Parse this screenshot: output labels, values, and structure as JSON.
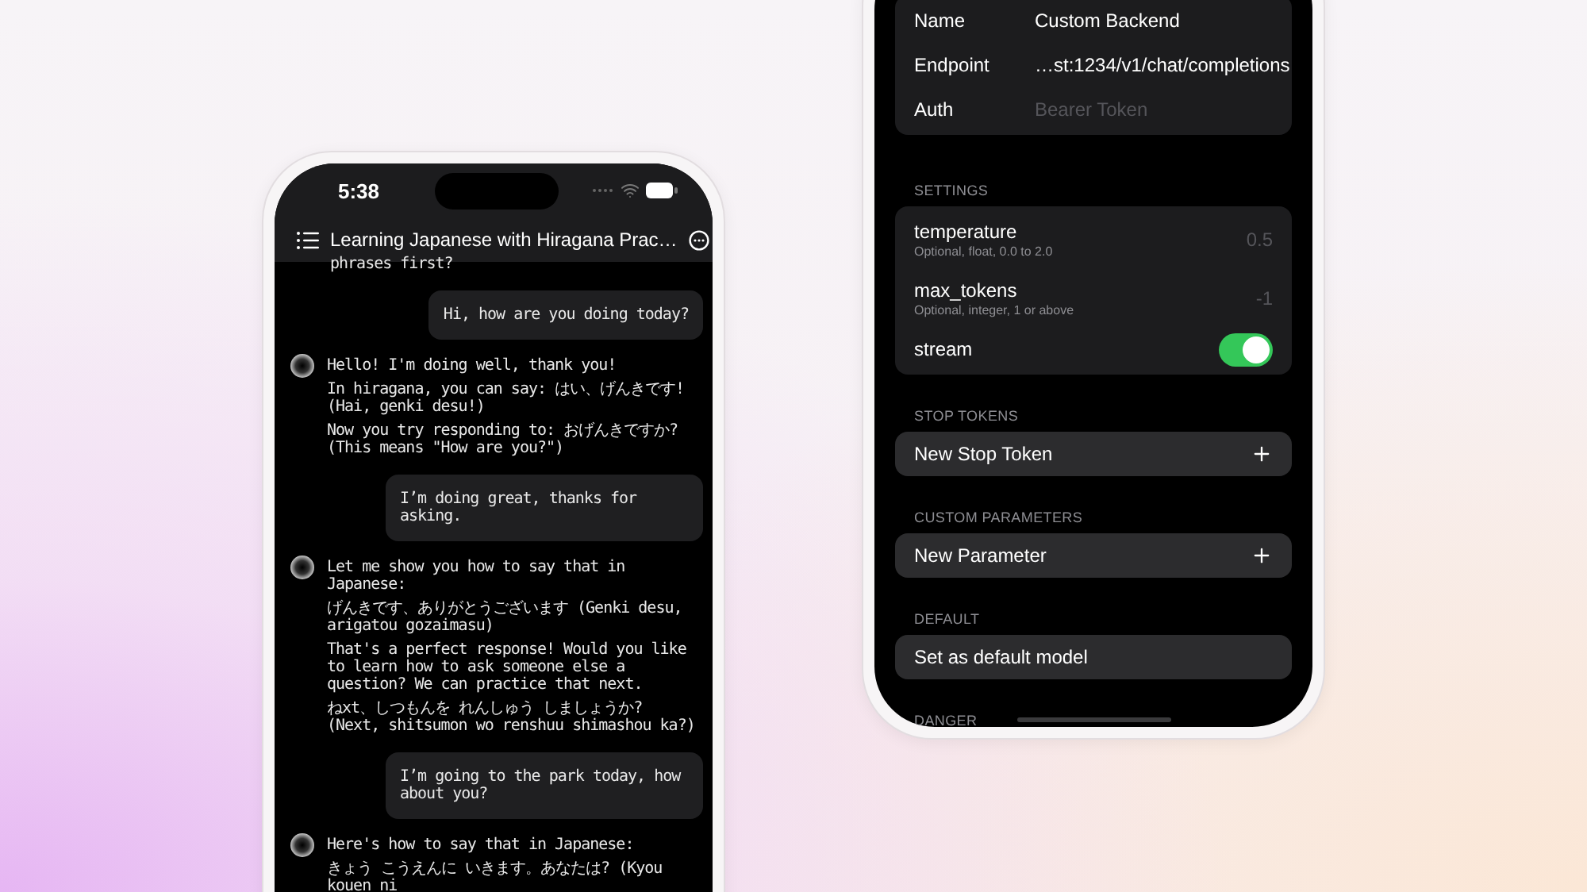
{
  "chat": {
    "time": "5:38",
    "title": "Learning Japanese with Hiragana Prac…",
    "messages": [
      {
        "kind": "assistant",
        "avatar": false,
        "paragraphs": [
          "phrases first?"
        ]
      },
      {
        "kind": "user",
        "paragraphs": [
          "Hi, how are you doing today?"
        ]
      },
      {
        "kind": "assistant",
        "avatar": true,
        "paragraphs": [
          "Hello! I'm doing well, thank you!",
          "In hiragana, you can say: はい、げんきです! (Hai, genki desu!)",
          "Now you try responding to: おげんきですか? (This means \"How are you?\")"
        ]
      },
      {
        "kind": "user",
        "paragraphs": [
          "I’m doing great, thanks for asking."
        ]
      },
      {
        "kind": "assistant",
        "avatar": true,
        "paragraphs": [
          "Let me show you how to say that in Japanese:",
          "げんきです、ありがとうございます (Genki desu, arigatou gozaimasu)",
          "That's a perfect response! Would you like to learn how to ask someone else a question? We can practice that next.",
          "ねxt、しつもんを れんしゅう しましょうか? (Next, shitsumon wo renshuu shimashou ka?)"
        ]
      },
      {
        "kind": "user",
        "paragraphs": [
          "I’m going to the park today, how about you?"
        ]
      },
      {
        "kind": "assistant",
        "avatar": true,
        "paragraphs": [
          "Here's how to say that in Japanese:",
          "きょう こうえんに いきます。あなたは? (Kyou kouen ni"
        ]
      }
    ]
  },
  "settings": {
    "connection": [
      {
        "label": "Name",
        "value": "Custom Backend"
      },
      {
        "label": "Endpoint",
        "value": "…st:1234/v1/chat/completions"
      },
      {
        "label": "Auth",
        "placeholder": "Bearer Token"
      }
    ],
    "sections": [
      {
        "title": "SETTINGS",
        "rows": [
          {
            "kind": "number",
            "label": "temperature",
            "hint": "Optional, float, 0.0 to 2.0",
            "placeholder": "0.5"
          },
          {
            "kind": "number",
            "label": "max_tokens",
            "hint": "Optional, integer, 1 or above",
            "placeholder": "-1"
          },
          {
            "kind": "toggle",
            "label": "stream",
            "on": true
          }
        ]
      },
      {
        "title": "STOP TOKENS",
        "rows": [
          {
            "kind": "add",
            "label": "New Stop Token"
          }
        ]
      },
      {
        "title": "CUSTOM PARAMETERS",
        "rows": [
          {
            "kind": "add",
            "label": "New Parameter"
          }
        ]
      },
      {
        "title": "DEFAULT",
        "rows": [
          {
            "kind": "action",
            "label": "Set as default model"
          }
        ]
      },
      {
        "title": "DANGER"
      }
    ]
  }
}
